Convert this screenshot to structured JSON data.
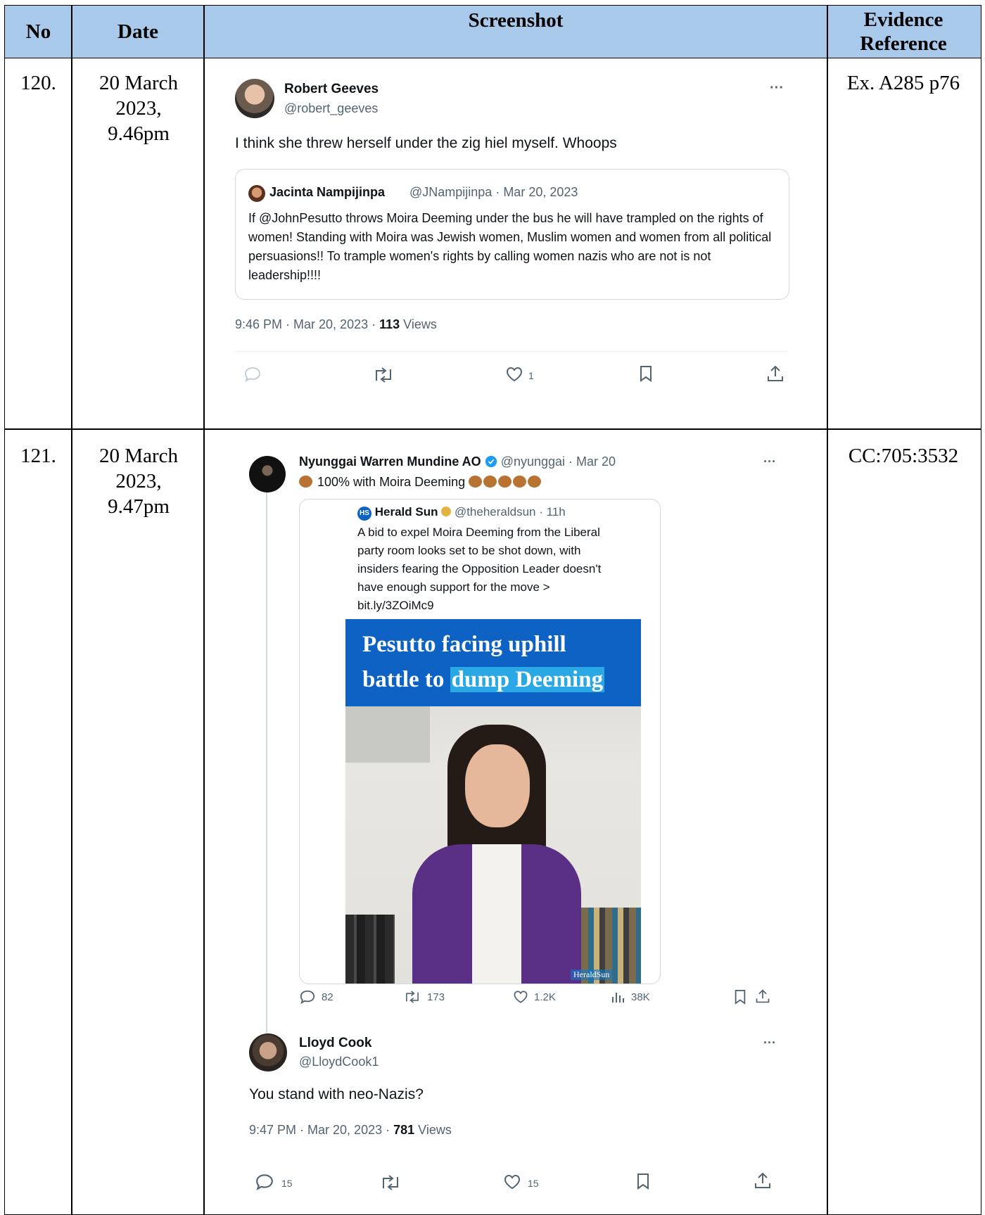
{
  "table": {
    "headers": {
      "no": "No",
      "date": "Date",
      "screenshot": "Screenshot",
      "evidence": "Evidence Reference"
    },
    "rows": [
      {
        "no": "120.",
        "date": "20 March 2023, 9.46pm",
        "evidence": "Ex. A285 p76",
        "tweet": {
          "author": "Robert Geeves",
          "handle": "@robert_geeves",
          "text": "I think she threw herself under the zig hiel myself. Whoops",
          "quote": {
            "author": "Jacinta Nampijinpa",
            "handle": "@JNampijinpa · Mar 20, 2023",
            "text": "If @JohnPesutto throws Moira Deeming under the bus he will have trampled on the rights of women! Standing with Moira was Jewish women, Muslim women and women from all political persuasions!! To trample women's rights by calling women nazis who are not is not leadership!!!!"
          },
          "meta_time": "9:46 PM · Mar 20, 2023 · ",
          "views_count": "113",
          "views_label": " Views",
          "likes": "1",
          "more": "···"
        }
      },
      {
        "no": "121.",
        "date": "20 March 2023, 9.47pm",
        "evidence": "CC:705:3532",
        "parent": {
          "author": "Nyunggai Warren Mundine AO",
          "handle": "@nyunggai · Mar 20",
          "text": "100% with Moira Deeming",
          "more": "···",
          "quote": {
            "badge": "HS",
            "author": "Herald Sun",
            "handle": "@theheraldsun · 11h",
            "text": "A bid to expel Moira Deeming from the Liberal party room looks set to be shot down, with insiders fearing the Opposition Leader doesn't have enough support for the move > bit.ly/3ZOiMc9",
            "headline_1": "Pesutto facing uphill",
            "headline_2a": "battle to ",
            "headline_2b": "dump Deeming",
            "watermark": "HeraldSun"
          },
          "stats": {
            "replies": "82",
            "retweets": "173",
            "likes": "1.2K",
            "views": "38K"
          }
        },
        "reply": {
          "author": "Lloyd Cook",
          "handle": "@LloydCook1",
          "text": "You stand with neo-Nazis?",
          "meta_time": "9:47 PM · Mar 20, 2023 · ",
          "views_count": "781",
          "views_label": " Views",
          "replies": "15",
          "likes": "15",
          "more": "···"
        }
      }
    ]
  },
  "colors": {
    "header_bg": "#a9c9ea",
    "twitter_blue": "#1d9bf0",
    "headline_bg": "#0d62c4"
  }
}
